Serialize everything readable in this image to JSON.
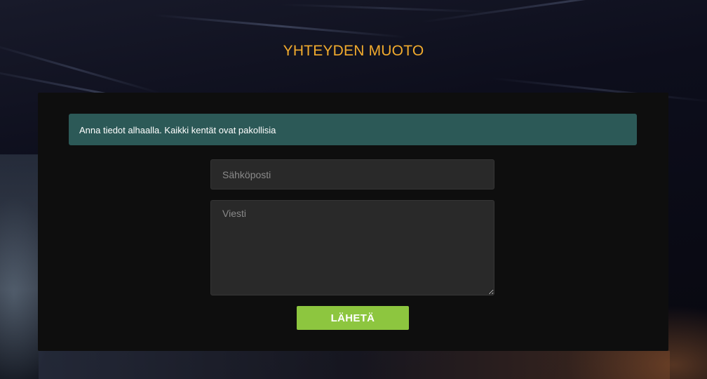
{
  "header": {
    "title": "YHTEYDEN MUOTO"
  },
  "form": {
    "notice": "Anna tiedot alhaalla. Kaikki kentät ovat pakollisia",
    "email_placeholder": "Sähköposti",
    "email_value": "",
    "message_placeholder": "Viesti",
    "message_value": "",
    "submit_label": "LÄHETÄ"
  },
  "colors": {
    "title": "#f2ab2d",
    "panel": "#0e0e0e",
    "notice_bg": "#2c5957",
    "field_bg": "#292929",
    "submit_bg": "#8dc63f"
  }
}
